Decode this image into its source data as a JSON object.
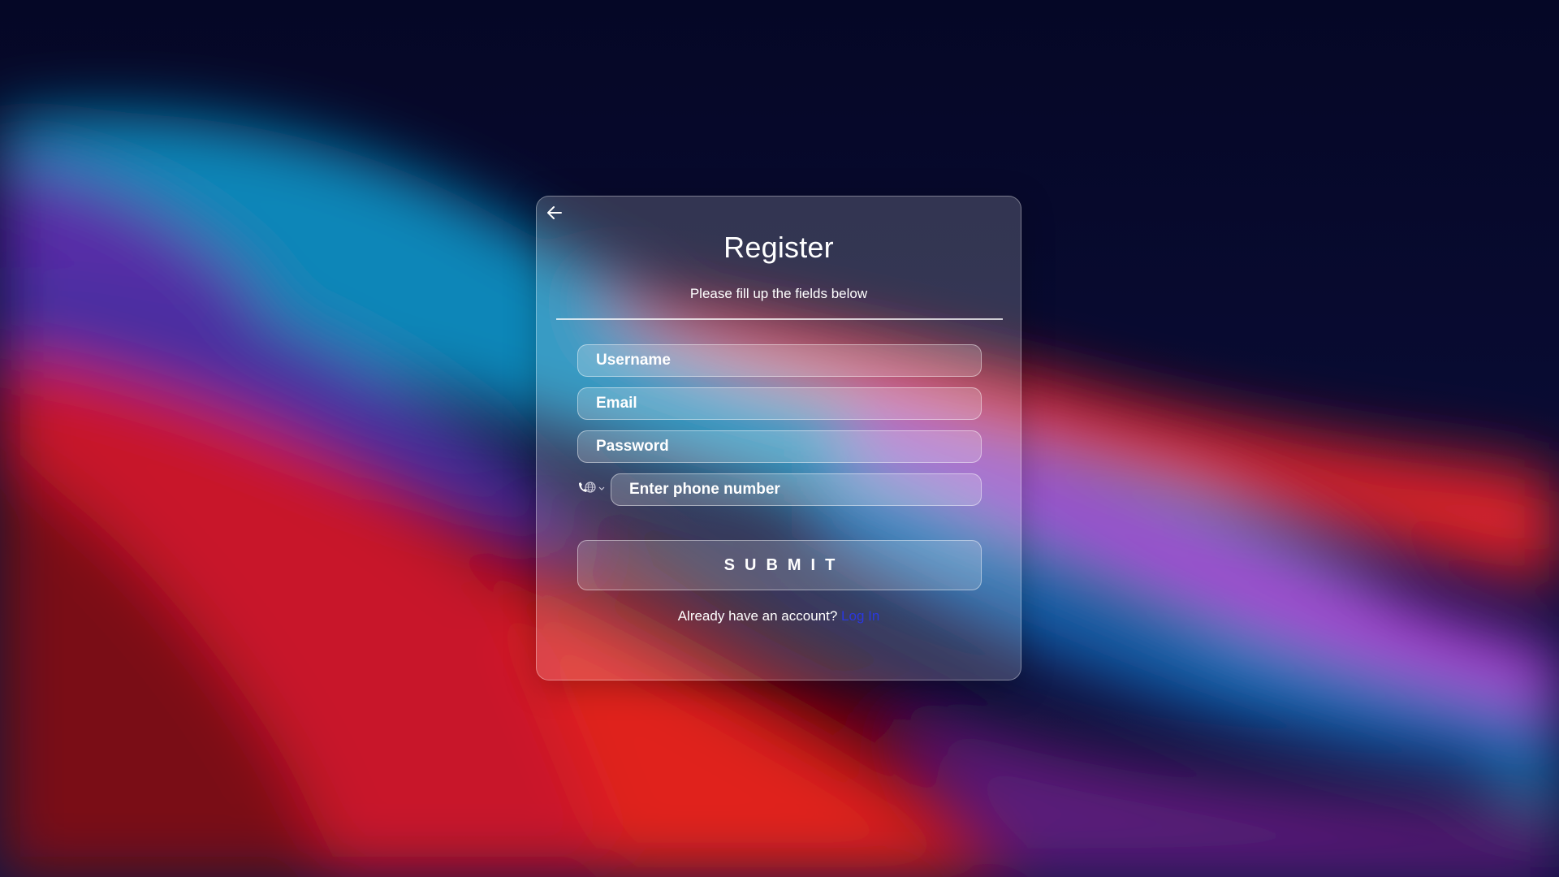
{
  "form": {
    "back_icon": "arrow-left-icon",
    "title": "Register",
    "subtitle": "Please fill up the fields below",
    "username_placeholder": "Username",
    "email_placeholder": "Email",
    "password_placeholder": "Password",
    "phone_country_icon": "phone-globe-icon",
    "phone_placeholder": "Enter phone number",
    "submit_label": "SUBMIT",
    "login_prompt": "Already have an account?",
    "login_link": "Log In"
  },
  "colors": {
    "link": "#2a38e0",
    "text": "#ffffff",
    "background_base": "#070a2a"
  }
}
